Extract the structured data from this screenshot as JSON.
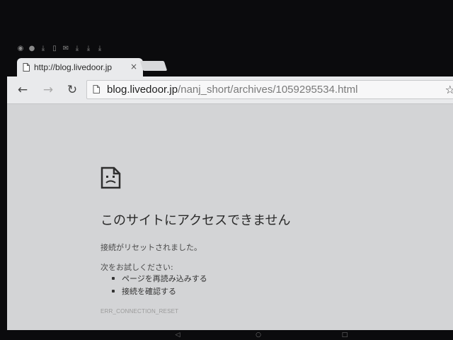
{
  "status_bar": {
    "icons": [
      "chrome-icon",
      "chat-icon",
      "download-icon",
      "phone-icon",
      "mail-icon",
      "download-icon",
      "download-icon",
      "download-icon"
    ]
  },
  "tab": {
    "title": "http://blog.livedoor.jp",
    "close_glyph": "×"
  },
  "toolbar": {
    "back_glyph": "←",
    "forward_glyph": "→",
    "reload_glyph": "↻",
    "url_host": "blog.livedoor.jp",
    "url_path": "/nanj_short/archives/1059295534.html",
    "star_glyph": "☆"
  },
  "error": {
    "title": "このサイトにアクセスできません",
    "description": "接続がリセットされました。",
    "try_label": "次をお試しください:",
    "suggestions": [
      "ページを再読み込みする",
      "接続を確認する"
    ],
    "code": "ERR_CONNECTION_RESET"
  },
  "colors": {
    "bezel": "#0b0b0d",
    "page_bg": "#d3d4d6",
    "toolbar_bg": "#e9eaec"
  }
}
